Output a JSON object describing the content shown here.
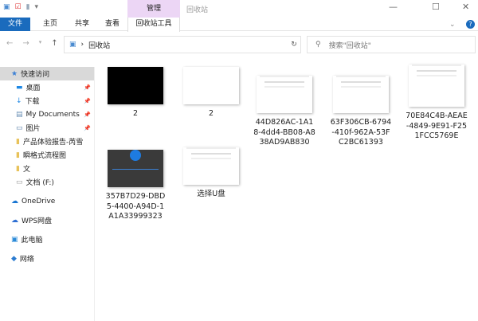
{
  "window": {
    "title": "回收站",
    "context_tab": "管理",
    "minimize": "—",
    "maximize": "☐",
    "close": "✕"
  },
  "ribbon": {
    "tabs": [
      "文件",
      "主页",
      "共享",
      "查看"
    ],
    "context_tool": "回收站工具",
    "help": "?"
  },
  "address": {
    "path": "回收站",
    "refresh": "↻",
    "search_placeholder": "搜索\"回收站\""
  },
  "sidebar": {
    "items": [
      {
        "label": "快速访问",
        "icon": "star-icon",
        "pinned": false
      },
      {
        "label": "桌面",
        "icon": "desktop-icon",
        "pinned": true
      },
      {
        "label": "下载",
        "icon": "download-icon",
        "pinned": true
      },
      {
        "label": "My Documents",
        "icon": "document-icon",
        "pinned": true
      },
      {
        "label": "图片",
        "icon": "pictures-icon",
        "pinned": true
      },
      {
        "label": "产品体验报告-芮雪",
        "icon": "folder-icon",
        "pinned": false
      },
      {
        "label": "瞬格式流程图",
        "icon": "folder-icon",
        "pinned": false
      },
      {
        "label": "文",
        "icon": "folder-icon",
        "pinned": false
      },
      {
        "label": "文档 (F:)",
        "icon": "drive-icon",
        "pinned": false
      },
      {
        "label": "OneDrive",
        "icon": "cloud-icon",
        "pinned": false
      },
      {
        "label": "WPS网盘",
        "icon": "wps-cloud-icon",
        "pinned": false
      },
      {
        "label": "此电脑",
        "icon": "computer-icon",
        "pinned": false
      },
      {
        "label": "网络",
        "icon": "network-icon",
        "pinned": false
      }
    ]
  },
  "files": [
    {
      "name": "2",
      "thumb": "black"
    },
    {
      "name": "2",
      "thumb": "white"
    },
    {
      "name": "44D826AC-1A18-4dd4-BB08-A838AD9AB830",
      "thumb": "screenshot"
    },
    {
      "name": "63F306CB-6794-410f-962A-53FC2BC61393",
      "thumb": "screenshot"
    },
    {
      "name": "70E84C4B-AEAE-4849-9E91-F251FCC5769E",
      "thumb": "dialog"
    },
    {
      "name": "357B7D29-DBD5-4400-A94D-1A1A33999323",
      "thumb": "dark"
    },
    {
      "name": "选择U盘",
      "thumb": "screenshot"
    }
  ]
}
